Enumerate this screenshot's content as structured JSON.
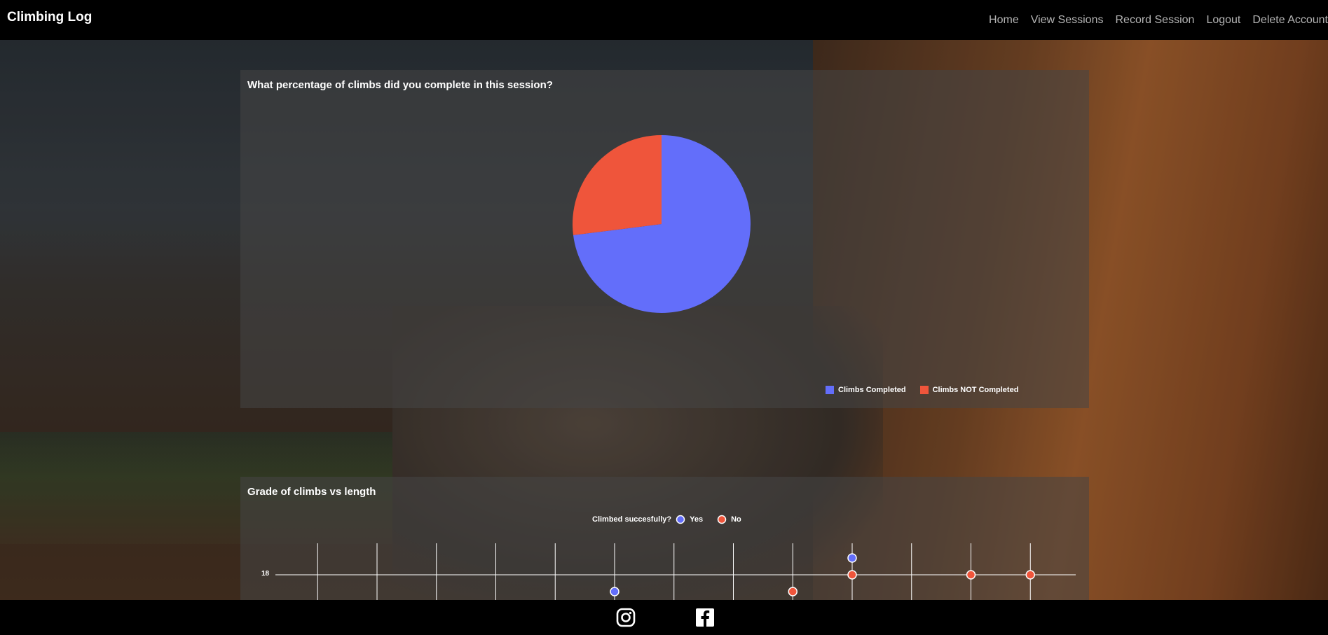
{
  "app": {
    "brand": "Climbing Log"
  },
  "nav": {
    "items": [
      "Home",
      "View Sessions",
      "Record Session",
      "Logout",
      "Delete Account"
    ]
  },
  "pie_card": {
    "title": "What percentage of climbs did you complete in this session?"
  },
  "scatter_card": {
    "title": "Grade of climbs vs length",
    "legend_title": "Climbed succesfully?"
  },
  "footer": {
    "icons": [
      "instagram-icon",
      "facebook-icon"
    ]
  },
  "colors": {
    "completed": "#636efa",
    "not_completed": "#ef553b"
  },
  "chart_data": [
    {
      "type": "pie",
      "title": "What percentage of climbs did you complete in this session?",
      "labels": [
        "Climbs Completed",
        "Climbs NOT Completed"
      ],
      "values": [
        73,
        27
      ],
      "colors": [
        "#636efa",
        "#ef553b"
      ],
      "legend_position": "bottom-right"
    },
    {
      "type": "scatter",
      "title": "Grade of climbs vs length",
      "legend_title": "Climbed succesfully?",
      "series": [
        {
          "name": "Yes",
          "color": "#636efa",
          "x": [
            6,
            10
          ],
          "y": [
            17.5,
            18.5
          ]
        },
        {
          "name": "No",
          "color": "#ef553b",
          "x": [
            9,
            10,
            12,
            13
          ],
          "y": [
            17.5,
            18,
            18,
            18
          ]
        }
      ],
      "yticks": [
        "18"
      ],
      "grid": true,
      "legend_position": "top-center"
    }
  ]
}
